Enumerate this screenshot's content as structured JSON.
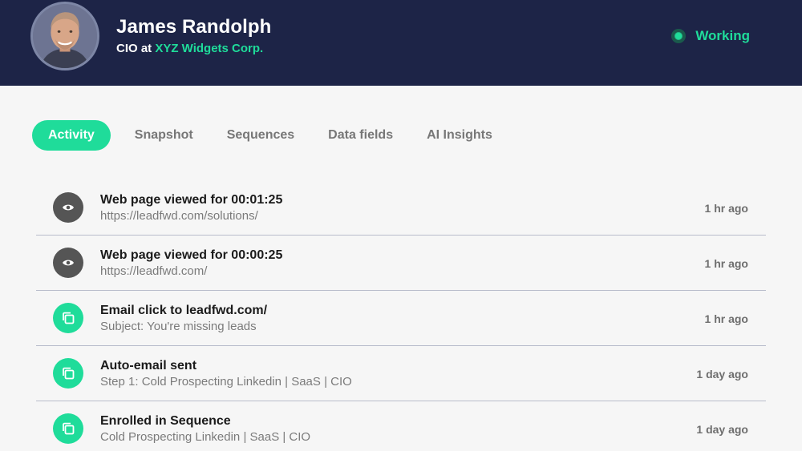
{
  "profile": {
    "name": "James Randolph",
    "role_prefix": "CIO at ",
    "company": "XYZ Widgets Corp.",
    "status": "Working",
    "avatar_icon": "person-photo"
  },
  "tabs": [
    {
      "label": "Activity",
      "active": true
    },
    {
      "label": "Snapshot",
      "active": false
    },
    {
      "label": "Sequences",
      "active": false
    },
    {
      "label": "Data fields",
      "active": false
    },
    {
      "label": "AI Insights",
      "active": false
    }
  ],
  "activity": [
    {
      "icon": "eye-icon",
      "title": "Web page viewed for 00:01:25",
      "subtitle": "https://leadfwd.com/solutions/",
      "time": "1 hr ago"
    },
    {
      "icon": "eye-icon",
      "title": "Web page viewed for 00:00:25",
      "subtitle": "https://leadfwd.com/",
      "time": "1 hr ago"
    },
    {
      "icon": "copy-icon",
      "title": "Email click to leadfwd.com/",
      "subtitle": "Subject: You're missing leads",
      "time": "1 hr ago"
    },
    {
      "icon": "copy-icon",
      "title": "Auto-email sent",
      "subtitle": "Step 1: Cold Prospecting Linkedin | SaaS | CIO",
      "time": "1 day ago"
    },
    {
      "icon": "copy-icon",
      "title": "Enrolled in Sequence",
      "subtitle": "Cold Prospecting Linkedin | SaaS | CIO",
      "time": "1 day ago"
    }
  ],
  "colors": {
    "header_bg": "#1d2447",
    "accent": "#1fdc9a",
    "view_icon_bg": "#555555"
  }
}
